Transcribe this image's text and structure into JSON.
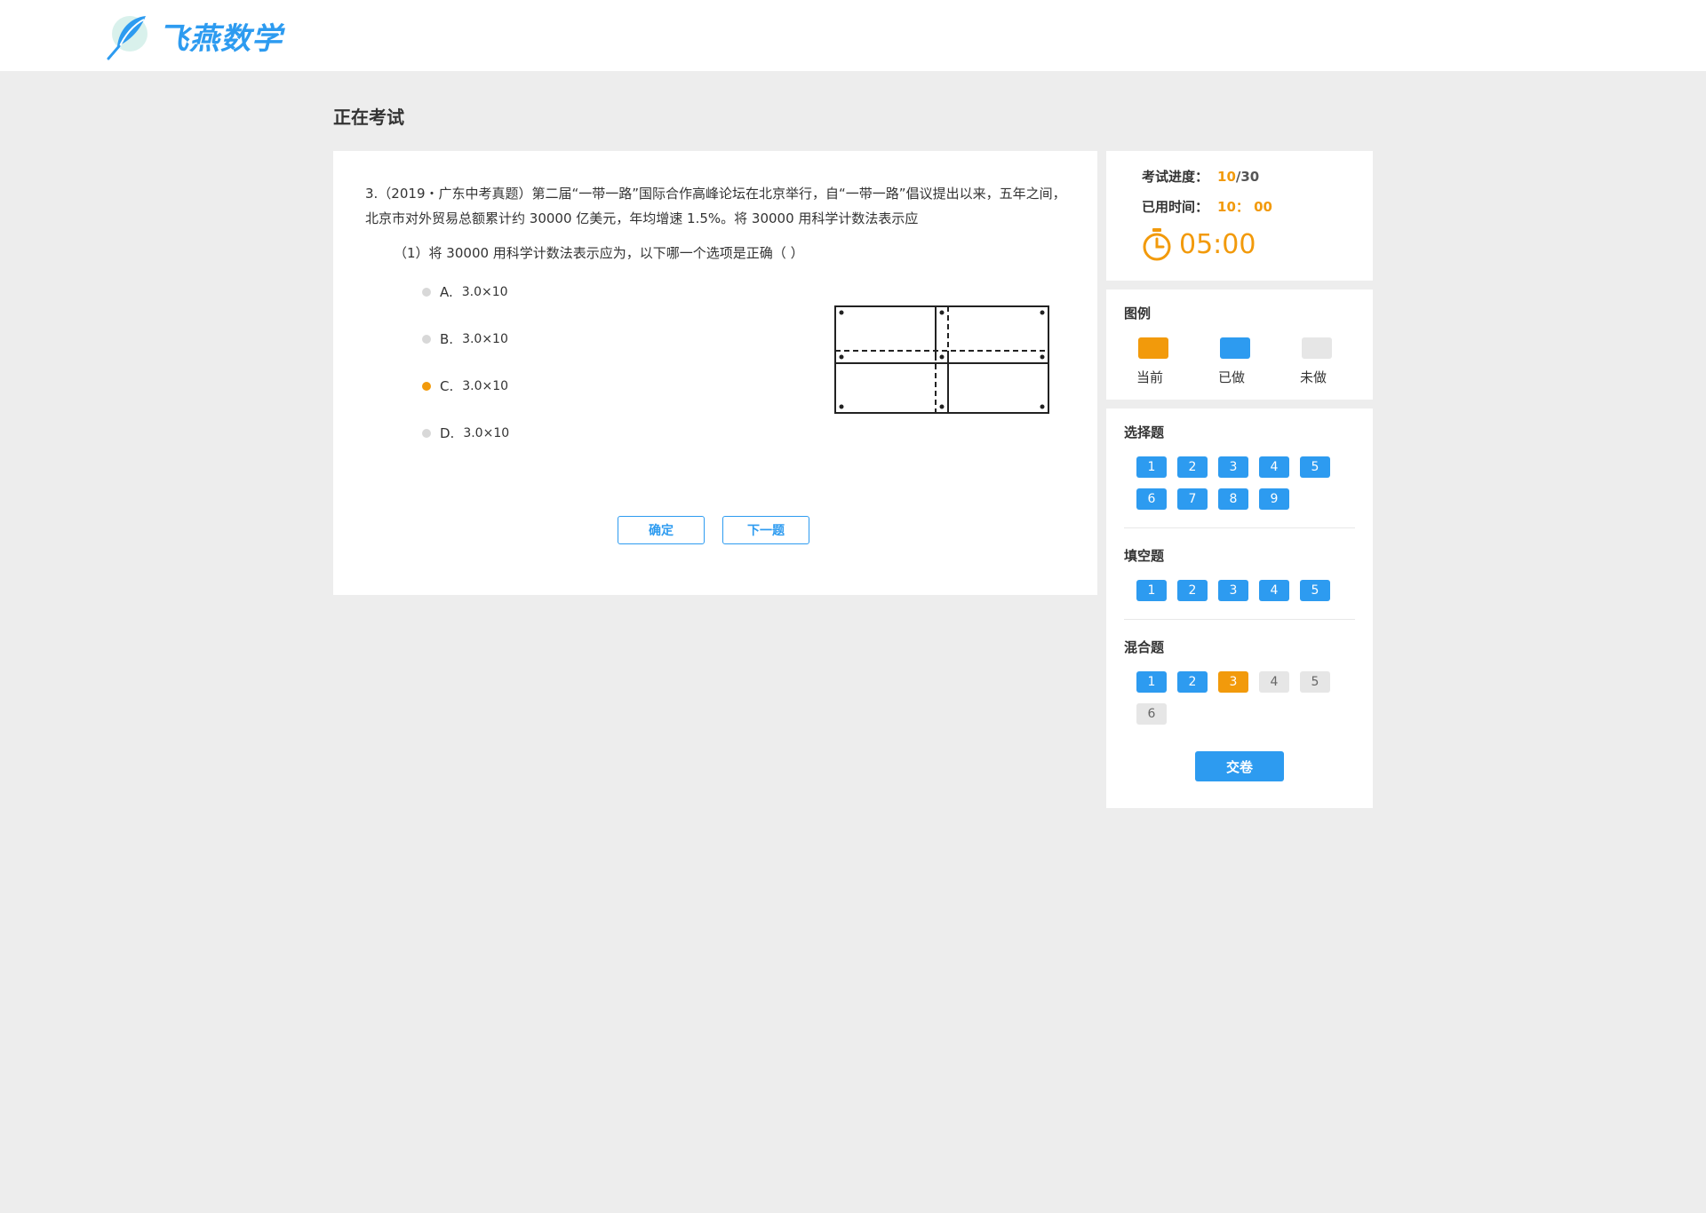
{
  "header": {
    "logo_text": "飞燕数学"
  },
  "page_title": "正在考试",
  "question": {
    "stem": "3.（2019・广东中考真题）第二届“一带一路”国际合作高峰论坛在北京举行，自“一带一路”倡议提出以来，五年之间，北京市对外贸易总额累计约 30000 亿美元，年均增速 1.5%。将 30000 用科学计数法表示应",
    "sub": "（1）将 30000 用科学计数法表示应为，以下哪一个选项是正确（    ）",
    "options": [
      {
        "letter": "A.",
        "text": "3.0×10"
      },
      {
        "letter": "B.",
        "text": "3.0×10"
      },
      {
        "letter": "C.",
        "text": "3.0×10"
      },
      {
        "letter": "D.",
        "text": "3.0×10"
      }
    ],
    "selected_option": "C."
  },
  "buttons": {
    "confirm": "确定",
    "next": "下一题",
    "submit": "交卷"
  },
  "progress": {
    "progress_label": "考试进度：",
    "current": "10",
    "total": "/30",
    "time_label": "已用时间：",
    "time_used": "10： 00",
    "countdown": "05:00"
  },
  "legend": {
    "title": "图例",
    "items": [
      {
        "label": "当前",
        "color": "#f29a0b"
      },
      {
        "label": "已做",
        "color": "#2d9bf0"
      },
      {
        "label": "未做",
        "color": "#e6e6e6"
      }
    ]
  },
  "sections": {
    "choice": {
      "title": "选择题",
      "items": [
        "1",
        "2",
        "3",
        "4",
        "5",
        "6",
        "7",
        "8",
        "9"
      ],
      "states": [
        "done",
        "done",
        "done",
        "done",
        "done",
        "done",
        "done",
        "done",
        "done"
      ]
    },
    "fill": {
      "title": "填空题",
      "items": [
        "1",
        "2",
        "3",
        "4",
        "5"
      ],
      "states": [
        "done",
        "done",
        "done",
        "done",
        "done"
      ]
    },
    "mixed": {
      "title": "混合题",
      "items": [
        "1",
        "2",
        "3",
        "4",
        "5",
        "6"
      ],
      "states": [
        "done",
        "done",
        "current",
        "todo",
        "todo",
        "todo"
      ]
    }
  },
  "colors": {
    "accent": "#2d9bf0",
    "current": "#f29a0b",
    "todo": "#e6e6e6"
  }
}
